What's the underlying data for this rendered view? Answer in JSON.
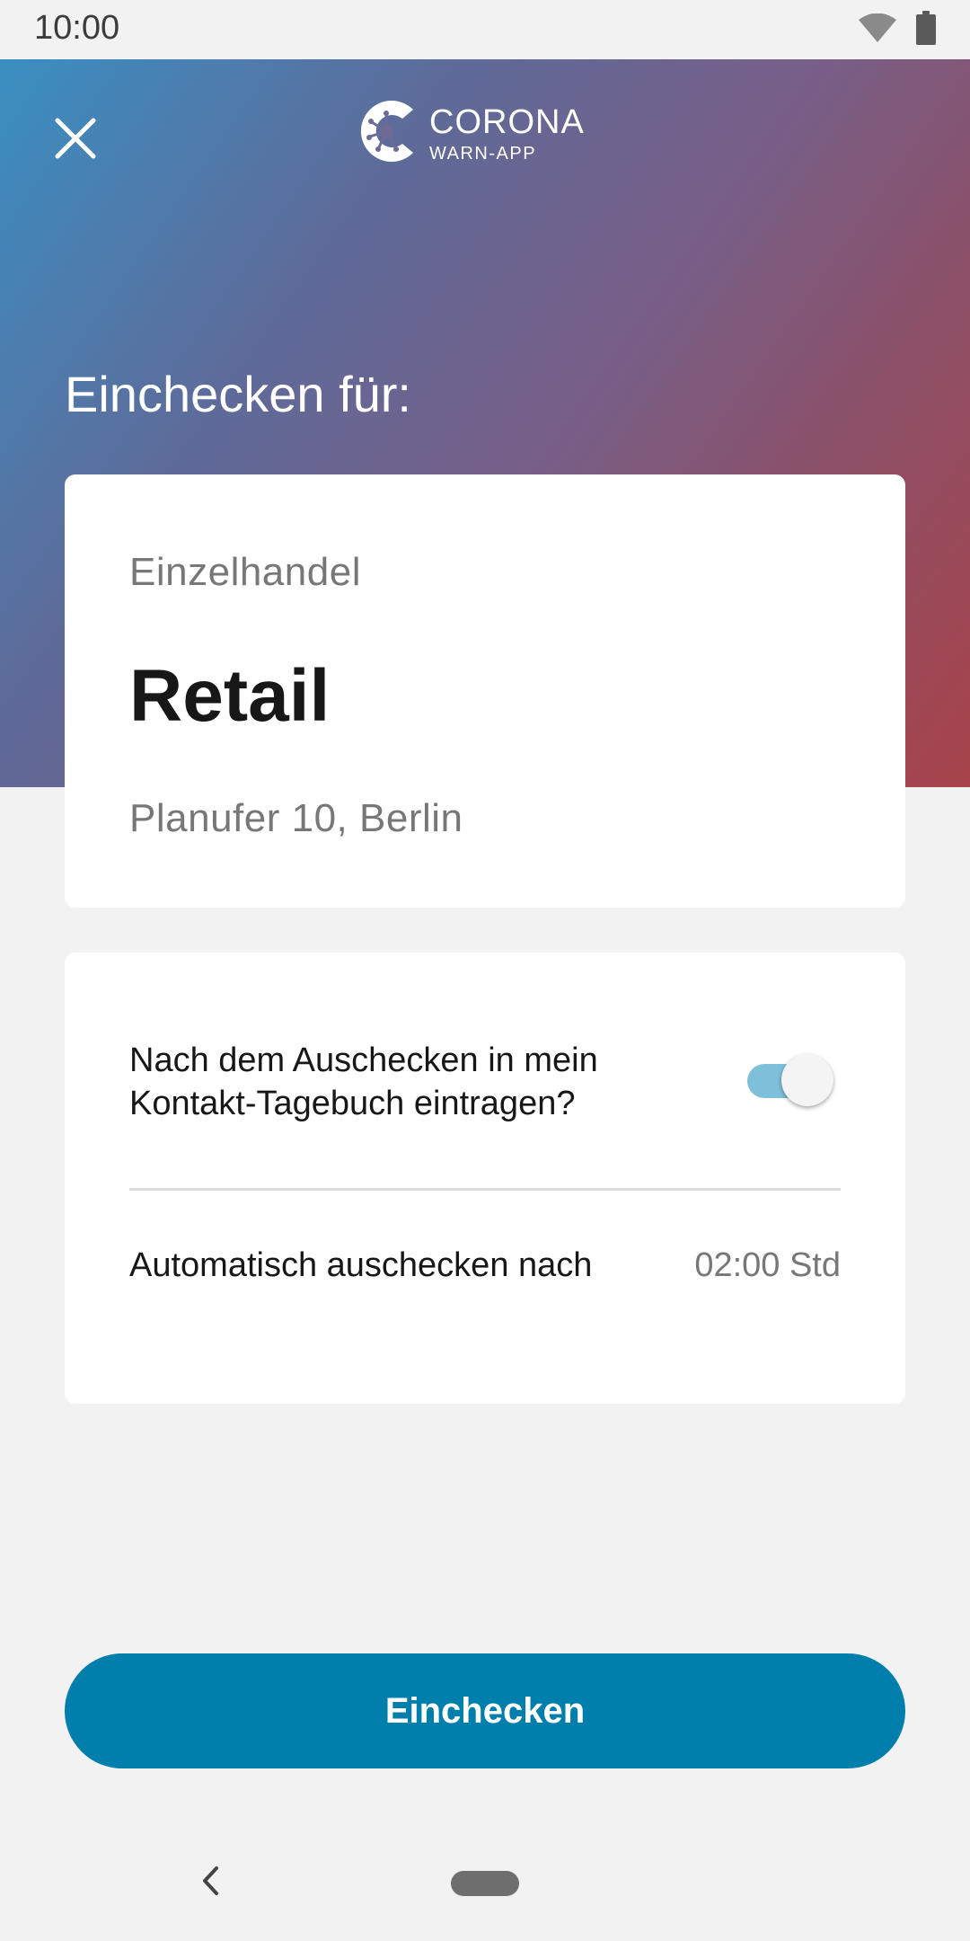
{
  "status_bar": {
    "time": "10:00",
    "icons": [
      "wifi-icon",
      "battery-icon"
    ]
  },
  "header": {
    "close_icon": "close-icon",
    "logo": {
      "title": "CORONA",
      "subtitle": "WARN-APP"
    },
    "title": "Einchecken für:"
  },
  "location": {
    "category": "Einzelhandel",
    "name": "Retail",
    "address": "Planufer 10, Berlin"
  },
  "settings": {
    "diary_label": "Nach dem Auschecken in mein Kontakt-Tagebuch eintragen?",
    "diary_toggle_on": true,
    "auto_checkout_label": "Automatisch auschecken nach",
    "auto_checkout_value": "02:00 Std"
  },
  "action": {
    "button_label": "Einchecken"
  },
  "nav_bar": {
    "icons": [
      "back-icon",
      "home-pill"
    ]
  },
  "colors": {
    "primary": "#007fad",
    "toggle_track": "#7ebfd9",
    "gradient_start": "#3a8fc2",
    "gradient_end": "#a8434a",
    "background": "#f2f2f2"
  }
}
